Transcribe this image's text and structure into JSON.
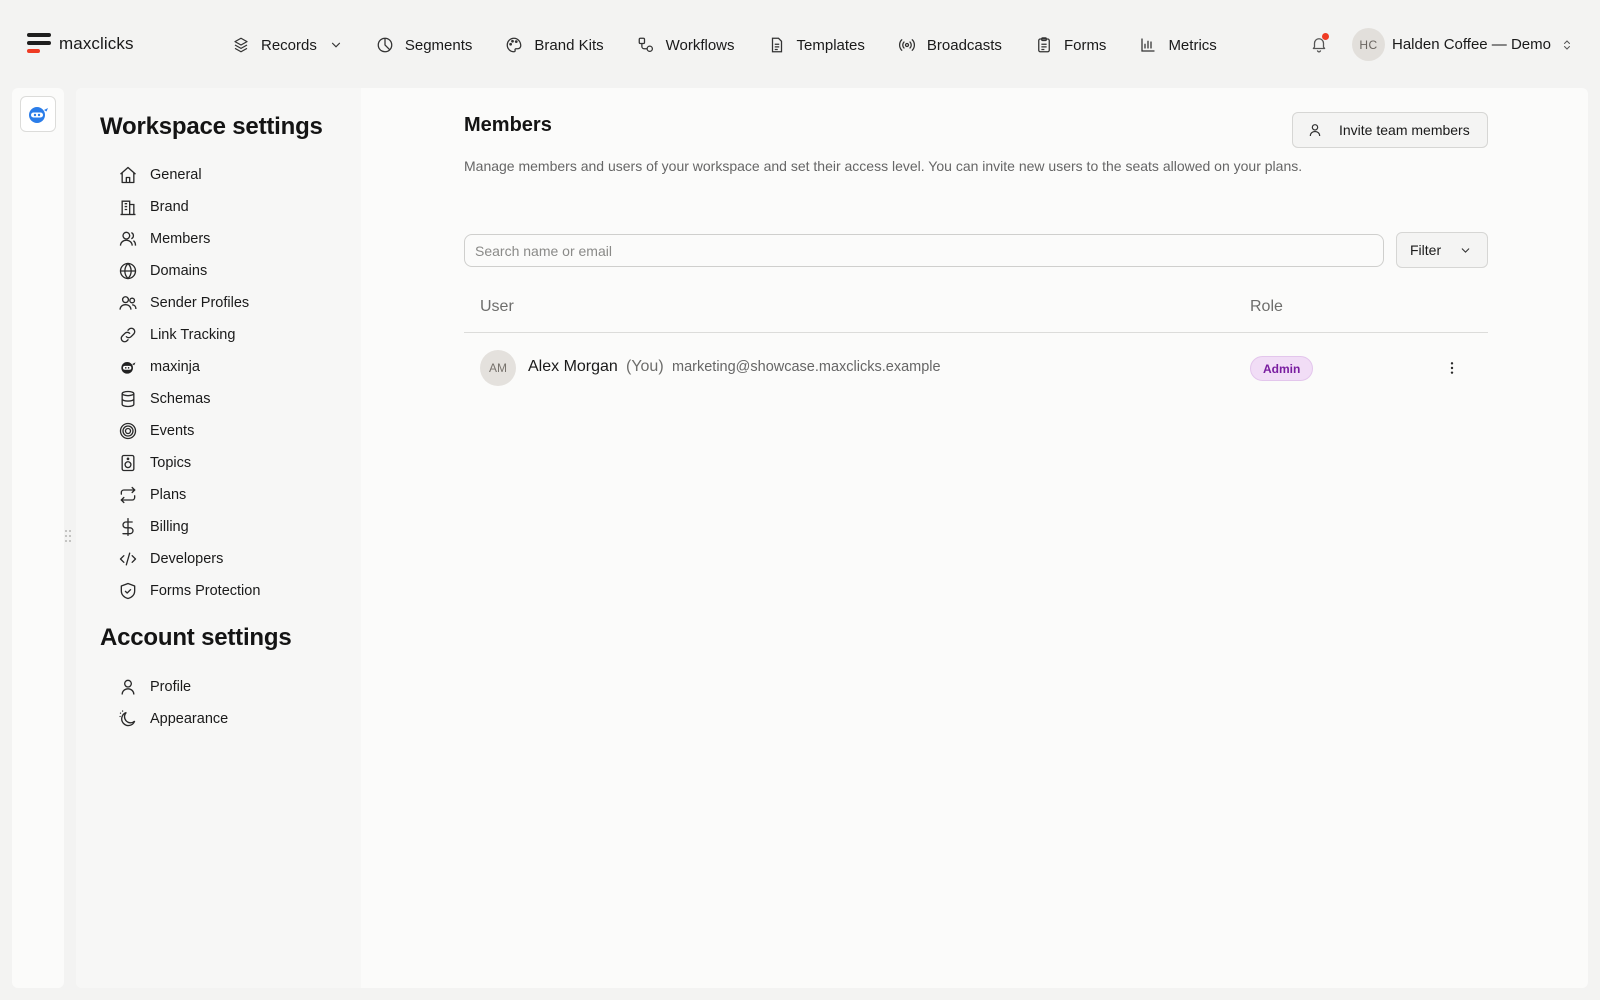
{
  "brand": {
    "name": "maxclicks",
    "colors": {
      "logo_dark": "#1e1e1e",
      "logo_accent": "#ef3b24",
      "notification": "#ef3b24",
      "admin_badge": "#7a1ea0",
      "rail_icon": "#2b7de9"
    }
  },
  "nav": {
    "items": [
      {
        "label": "Records",
        "icon": "layers-icon",
        "dropdown": true
      },
      {
        "label": "Segments",
        "icon": "pie-chart-icon"
      },
      {
        "label": "Brand Kits",
        "icon": "palette-icon"
      },
      {
        "label": "Workflows",
        "icon": "workflow-icon"
      },
      {
        "label": "Templates",
        "icon": "document-icon"
      },
      {
        "label": "Broadcasts",
        "icon": "broadcast-icon"
      },
      {
        "label": "Forms",
        "icon": "clipboard-icon"
      },
      {
        "label": "Metrics",
        "icon": "bar-chart-icon"
      }
    ]
  },
  "header": {
    "notifications_unread": true,
    "workspace": {
      "initials": "HC",
      "name": "Halden Coffee — Demo"
    }
  },
  "sidebar": {
    "workspace_heading": "Workspace settings",
    "workspace_items": [
      {
        "label": "General",
        "icon": "home-icon"
      },
      {
        "label": "Brand",
        "icon": "building-icon"
      },
      {
        "label": "Members",
        "icon": "user-icon",
        "active": true
      },
      {
        "label": "Domains",
        "icon": "globe-icon"
      },
      {
        "label": "Sender Profiles",
        "icon": "users-icon"
      },
      {
        "label": "Link Tracking",
        "icon": "link-icon"
      },
      {
        "label": "maxinja",
        "icon": "ninja-icon"
      },
      {
        "label": "Schemas",
        "icon": "database-icon"
      },
      {
        "label": "Events",
        "icon": "target-icon"
      },
      {
        "label": "Topics",
        "icon": "speaker-icon"
      },
      {
        "label": "Plans",
        "icon": "repeat-icon"
      },
      {
        "label": "Billing",
        "icon": "dollar-icon"
      },
      {
        "label": "Developers",
        "icon": "code-icon"
      },
      {
        "label": "Forms Protection",
        "icon": "shield-check-icon"
      }
    ],
    "account_heading": "Account settings",
    "account_items": [
      {
        "label": "Profile",
        "icon": "user-icon"
      },
      {
        "label": "Appearance",
        "icon": "moon-icon"
      }
    ]
  },
  "main": {
    "title": "Members",
    "description": "Manage members and users of your workspace and set their access level. You can invite new users to the seats allowed on your plans.",
    "invite_label": "Invite team members",
    "search_placeholder": "Search name or email",
    "search_value": "",
    "filter_label": "Filter",
    "columns": [
      "User",
      "Role"
    ],
    "members": [
      {
        "initials": "AM",
        "name": "Alex Morgan",
        "you_tag": "(You)",
        "email": "marketing@showcase.maxclicks.example",
        "role": "Admin"
      }
    ]
  }
}
